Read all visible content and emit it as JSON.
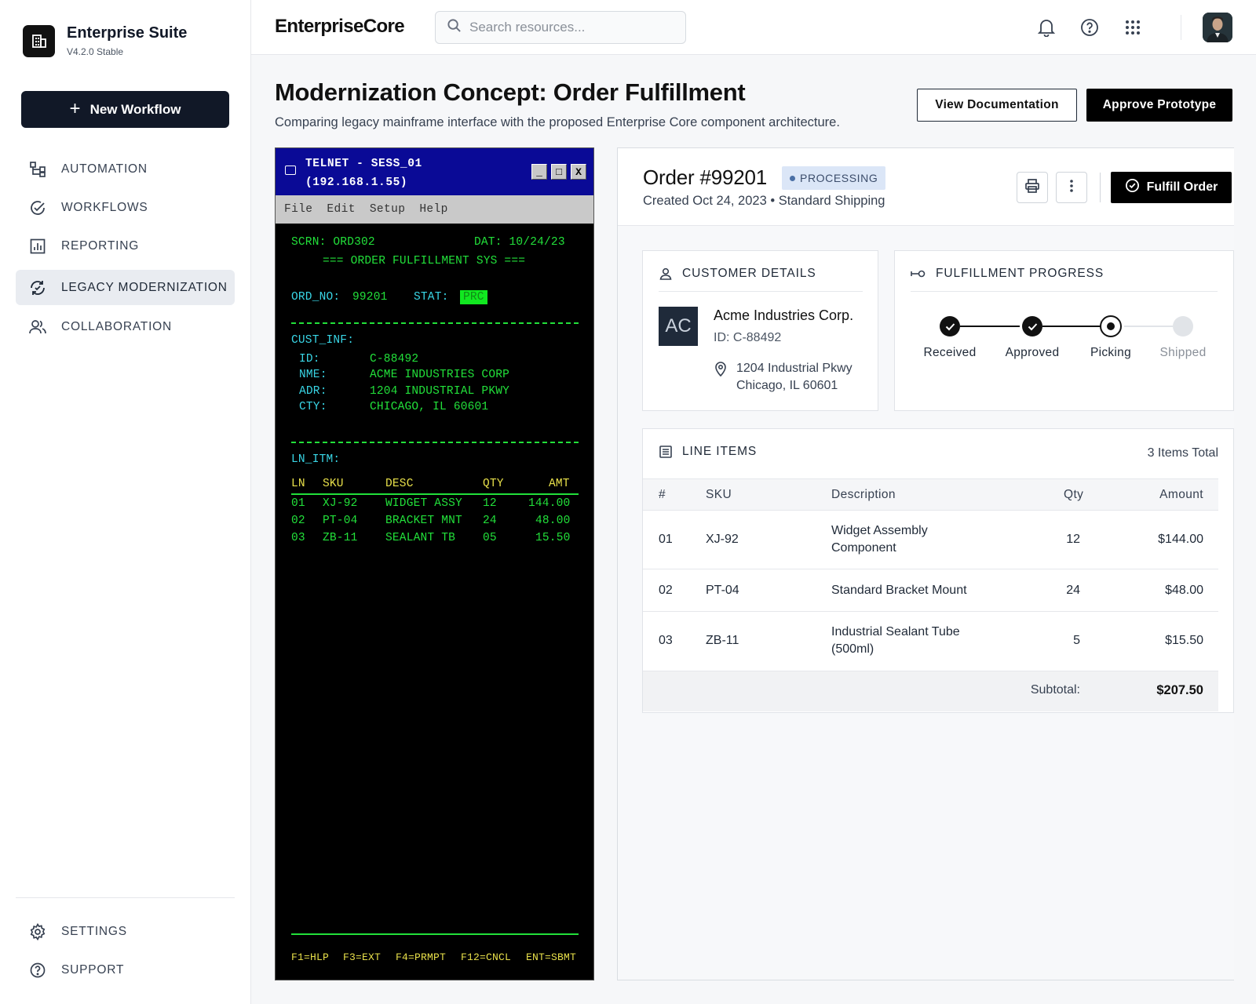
{
  "sidebar": {
    "brand_name": "Enterprise Suite",
    "brand_version": "V4.2.0 Stable",
    "new_workflow_label": "New Workflow",
    "nav": [
      {
        "label": "AUTOMATION",
        "icon": "hierarchy-icon"
      },
      {
        "label": "WORKFLOWS",
        "icon": "check-circle-icon"
      },
      {
        "label": "REPORTING",
        "icon": "bar-chart-icon"
      },
      {
        "label": "LEGACY MODERNIZATION",
        "icon": "refresh-check-icon",
        "active": true
      },
      {
        "label": "COLLABORATION",
        "icon": "users-icon"
      }
    ],
    "bottom_nav": [
      {
        "label": "SETTINGS",
        "icon": "gear-icon"
      },
      {
        "label": "SUPPORT",
        "icon": "help-circle-icon"
      }
    ]
  },
  "topbar": {
    "app_title": "EnterpriseCore",
    "search_placeholder": "Search resources..."
  },
  "page": {
    "title": "Modernization Concept: Order Fulfillment",
    "subtitle": "Comparing legacy mainframe interface with the proposed Enterprise Core component architecture.",
    "view_docs_label": "View Documentation",
    "approve_label": "Approve Prototype"
  },
  "terminal": {
    "title_line1": "TELNET - SESS_01",
    "title_line2": "(192.168.1.55)",
    "min_btn": "_",
    "max_btn": "□",
    "close_btn": "X",
    "menu": [
      "File",
      "Edit",
      "Setup",
      "Help"
    ],
    "scrn": "SCRN: ORD302",
    "dat": "DAT: 10/24/23",
    "header": "=== ORDER FULFILLMENT SYS ===",
    "ord_no_label": "ORD_NO:",
    "ord_no": "99201",
    "stat_label": "STAT:",
    "stat": "PRC",
    "cust_inf": "CUST_INF:",
    "cust_rows": [
      {
        "k": "ID:",
        "v": "C-88492"
      },
      {
        "k": "NME:",
        "v": "ACME INDUSTRIES CORP"
      },
      {
        "k": "ADR:",
        "v": "1204 INDUSTRIAL PKWY"
      },
      {
        "k": "CTY:",
        "v": "CHICAGO, IL 60601"
      }
    ],
    "ln_itm": "LN_ITM:",
    "cols": [
      "LN",
      "SKU",
      "DESC",
      "QTY",
      "AMT"
    ],
    "items": [
      [
        "01",
        "XJ-92",
        "WIDGET ASSY",
        "12",
        "144.00"
      ],
      [
        "02",
        "PT-04",
        "BRACKET MNT",
        "24",
        "48.00"
      ],
      [
        "03",
        "ZB-11",
        "SEALANT TB",
        "05",
        "15.50"
      ]
    ],
    "fkeys": [
      "F1=HLP",
      "F3=EXT",
      "F4=PRMPT",
      "F12=CNCL",
      "ENT=SBMT"
    ]
  },
  "order": {
    "number": "Order #99201",
    "status": "PROCESSING",
    "meta": "Created Oct 24, 2023 • Standard Shipping",
    "fulfill_label": "Fulfill Order"
  },
  "customer": {
    "heading": "CUSTOMER DETAILS",
    "initials": "AC",
    "name": "Acme Industries Corp.",
    "id": "ID: C-88492",
    "address_line1": "1204 Industrial Pkwy",
    "address_line2": "Chicago, IL 60601"
  },
  "progress": {
    "heading": "FULFILLMENT PROGRESS",
    "steps": [
      {
        "label": "Received",
        "state": "done"
      },
      {
        "label": "Approved",
        "state": "done"
      },
      {
        "label": "Picking",
        "state": "current"
      },
      {
        "label": "Shipped",
        "state": "todo"
      }
    ]
  },
  "line_items": {
    "heading": "LINE ITEMS",
    "count": "3 Items Total",
    "columns": [
      "#",
      "SKU",
      "Description",
      "Qty",
      "Amount"
    ],
    "rows": [
      {
        "n": "01",
        "sku": "XJ-92",
        "desc1": "Widget Assembly",
        "desc2": "Component",
        "qty": "12",
        "amount": "$144.00"
      },
      {
        "n": "02",
        "sku": "PT-04",
        "desc1": "Standard Bracket Mount",
        "desc2": "",
        "qty": "24",
        "amount": "$48.00"
      },
      {
        "n": "03",
        "sku": "ZB-11",
        "desc1": "Industrial Sealant Tube",
        "desc2": "(500ml)",
        "qty": "5",
        "amount": "$15.50"
      }
    ],
    "subtotal_label": "Subtotal:",
    "subtotal_value": "$207.50"
  },
  "colors": {
    "primary": "#111827",
    "terminal_green": "#22e03a",
    "terminal_cyan": "#39d6e6",
    "terminal_yellow": "#e8e04a",
    "terminal_title": "#0a0a96",
    "status_badge_bg": "#dbe6f7"
  }
}
